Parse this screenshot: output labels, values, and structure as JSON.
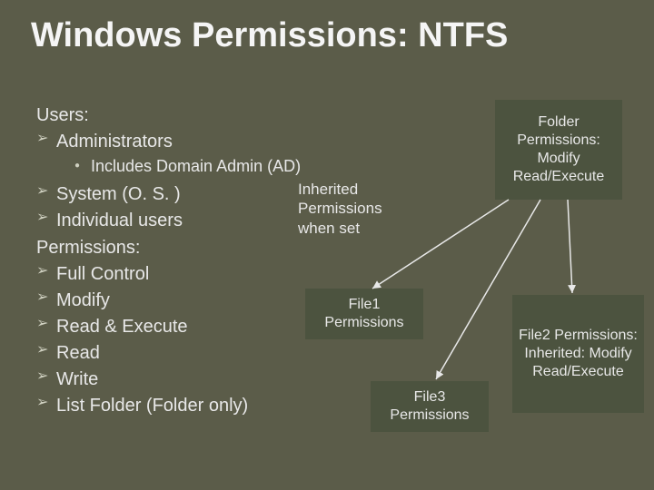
{
  "title": "Windows Permissions: NTFS",
  "users_heading": "Users:",
  "users": {
    "admin": "Administrators",
    "admin_sub": "Includes Domain Admin (AD)",
    "system": "System (O. S. )",
    "individual": "Individual users"
  },
  "perm_heading": "Permissions:",
  "perms": {
    "full": "Full Control",
    "modify": "Modify",
    "readexec": "Read & Execute",
    "read": "Read",
    "write": "Write",
    "list": "List Folder (Folder only)"
  },
  "folder_box": "Folder Permissions: Modify Read/Execute",
  "inherited_box": "Inherited Permissions when set",
  "file1_box": "File1 Permissions",
  "file2_box": "File2 Permissions: Inherited: Modify Read/Execute",
  "file3_box": "File3 Permissions"
}
